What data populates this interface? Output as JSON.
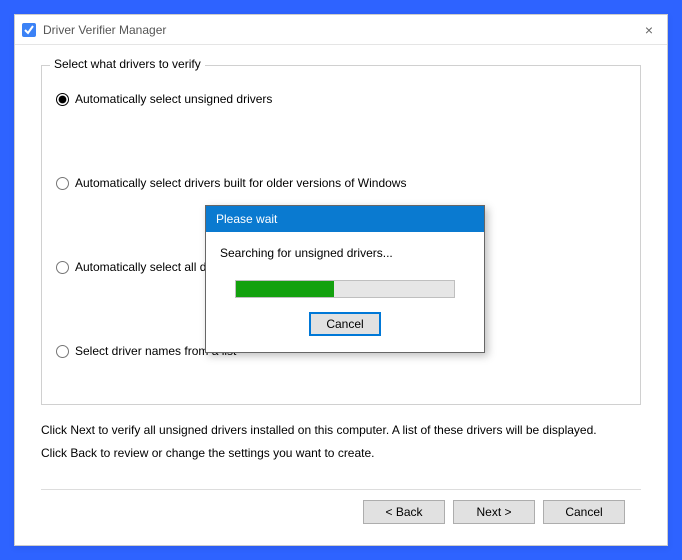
{
  "window": {
    "title": "Driver Verifier Manager",
    "iconName": "app-icon",
    "close": "×"
  },
  "group": {
    "label": "Select what drivers to verify",
    "options": [
      {
        "label": "Automatically select unsigned drivers"
      },
      {
        "label": "Automatically select drivers built for older versions of Windows"
      },
      {
        "label": "Automatically select all drivers installed on this computer"
      },
      {
        "label": "Select driver names from a list"
      }
    ],
    "selectedIndex": 0
  },
  "hint": {
    "line1": "Click Next to verify all unsigned drivers installed on this computer. A list of these drivers will be displayed.",
    "line2": "Click Back to review or change the settings you want to create."
  },
  "buttons": {
    "back": "< Back",
    "next": "Next >",
    "cancel": "Cancel"
  },
  "modal": {
    "title": "Please wait",
    "message": "Searching for unsigned drivers...",
    "progressPercent": 45,
    "cancel": "Cancel"
  }
}
